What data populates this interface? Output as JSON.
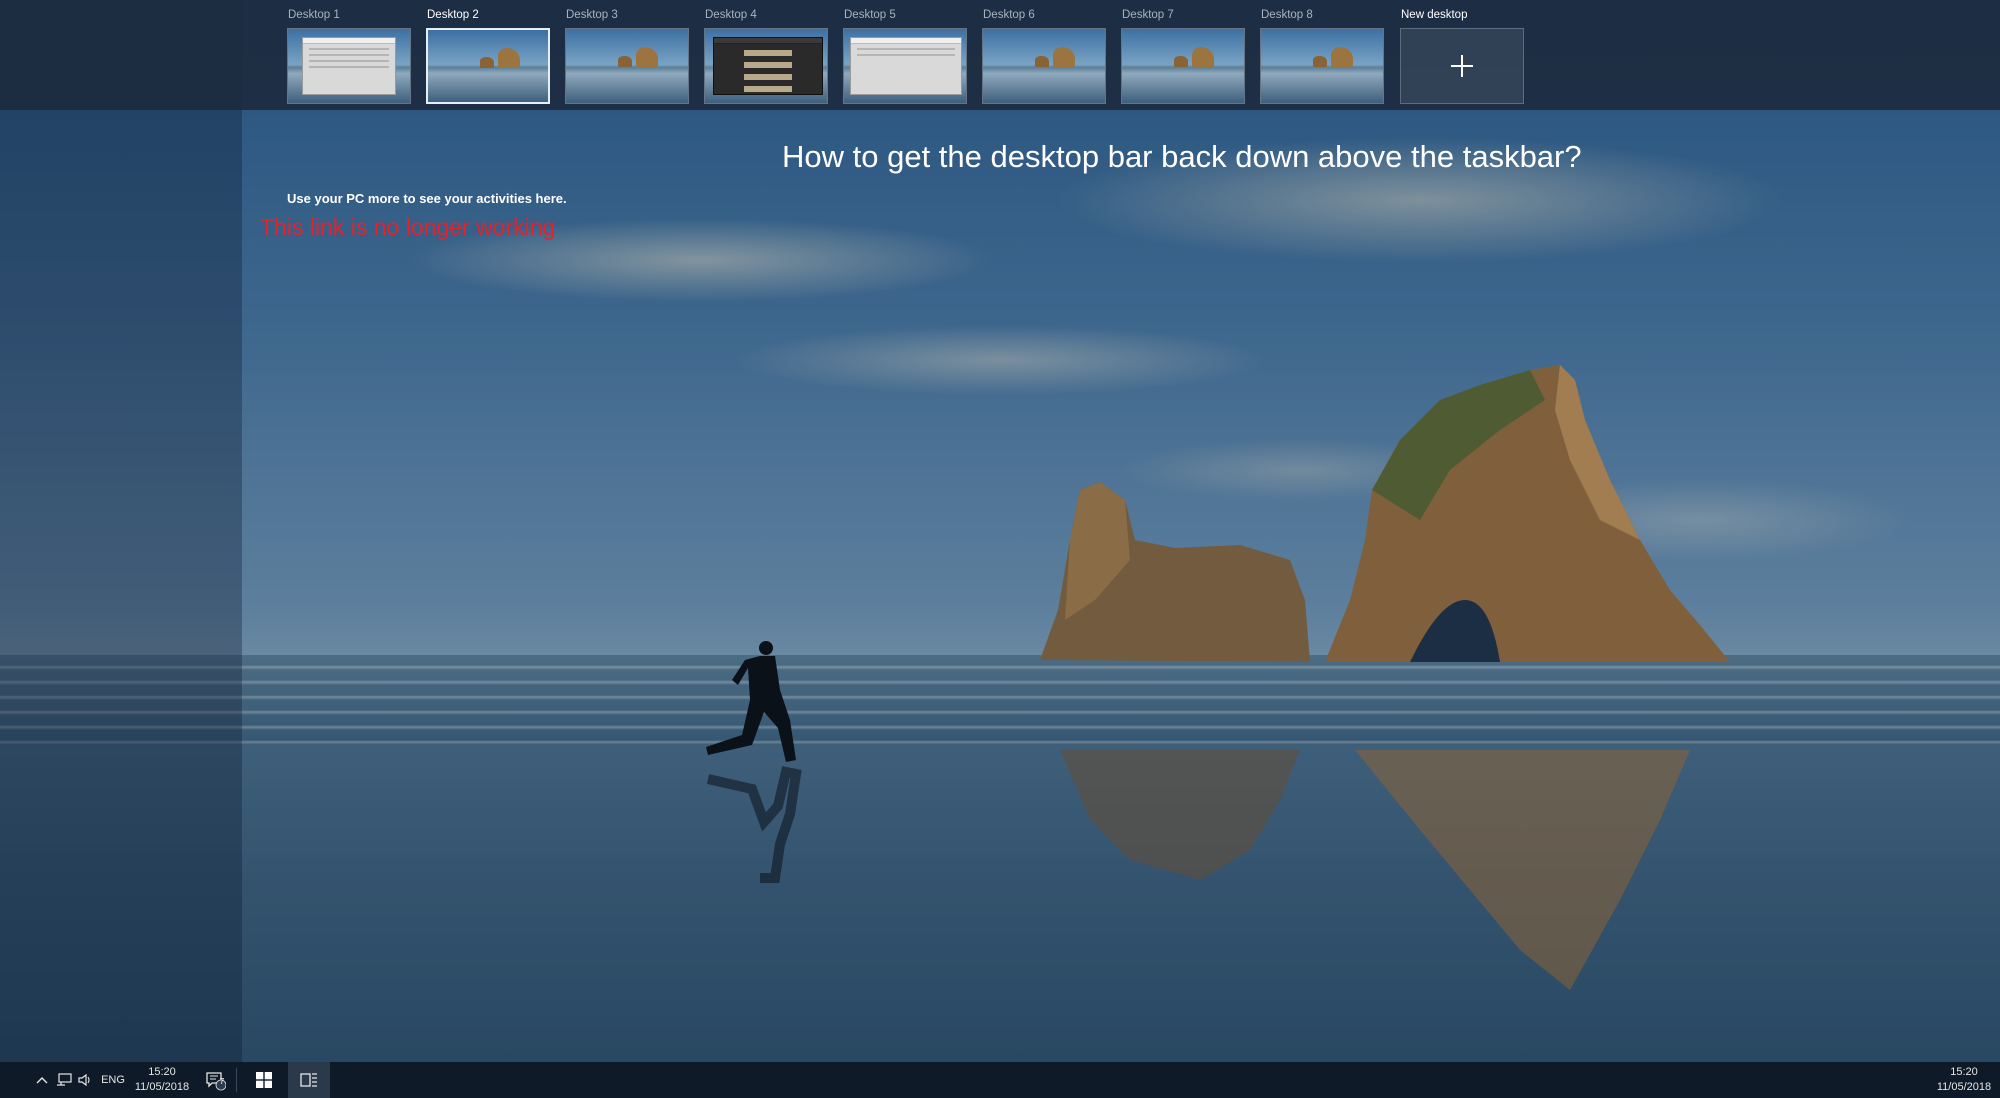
{
  "desktops": [
    {
      "label": "Desktop 1",
      "active": false,
      "thumbnail": "window"
    },
    {
      "label": "Desktop 2",
      "active": true,
      "thumbnail": "wallpaper"
    },
    {
      "label": "Desktop 3",
      "active": false,
      "thumbnail": "wallpaper"
    },
    {
      "label": "Desktop 4",
      "active": false,
      "thumbnail": "dark-window"
    },
    {
      "label": "Desktop 5",
      "active": false,
      "thumbnail": "window"
    },
    {
      "label": "Desktop 6",
      "active": false,
      "thumbnail": "wallpaper"
    },
    {
      "label": "Desktop 7",
      "active": false,
      "thumbnail": "wallpaper"
    },
    {
      "label": "Desktop 8",
      "active": false,
      "thumbnail": "wallpaper"
    }
  ],
  "new_desktop": {
    "label": "New desktop"
  },
  "overlay": {
    "question": "How to get the desktop bar back down above the taskbar?",
    "activity_hint": "Use your PC more to see your activities here.",
    "link_note": "This link is no longer working"
  },
  "taskbar_left": {
    "language": "ENG",
    "time": "15:20",
    "date": "11/05/2018",
    "notification_count": "7"
  },
  "taskbar_right": {
    "time": "15:20",
    "date": "11/05/2018"
  },
  "icons": {
    "tray_overflow": "chevron-up-icon",
    "network": "network-icon",
    "volume": "volume-icon",
    "action_center": "action-center-icon",
    "start": "windows-logo-icon",
    "task_view": "task-view-icon",
    "new_desktop": "plus-icon"
  },
  "colors": {
    "link_note": "#e8202a",
    "taskbar": "#0e1a27",
    "desktop_strip": "#1c2a3e"
  }
}
